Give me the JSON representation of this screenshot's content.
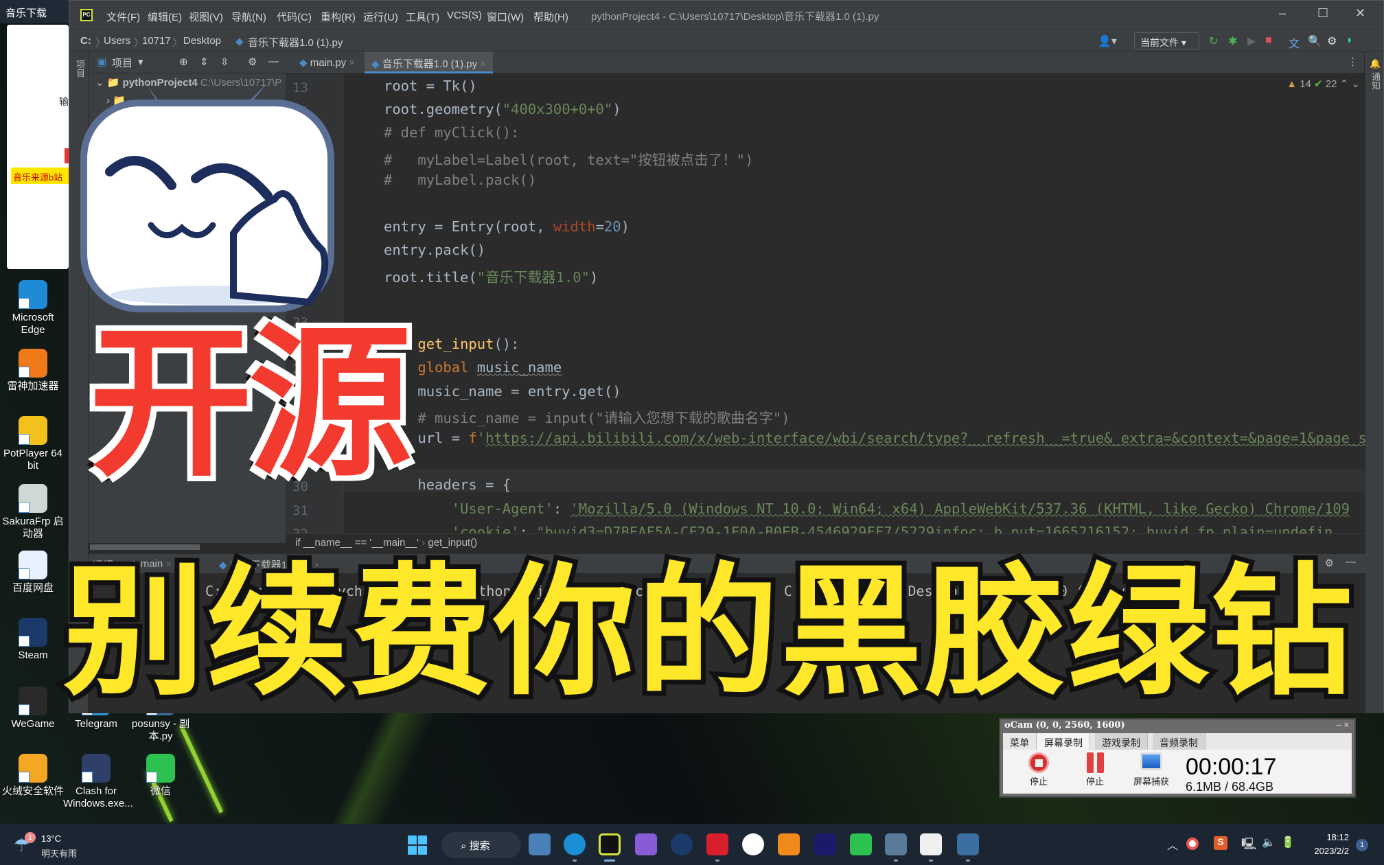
{
  "left_window": {
    "title": "音乐下载",
    "tag": "音乐来源b站",
    "char": "输"
  },
  "desktop_icons": [
    {
      "label": "Microsoft Edge",
      "color": "#1f8ad6"
    },
    {
      "label": "雷神加速器",
      "color": "#f07a1a"
    },
    {
      "label": "PotPlayer 64 bit",
      "color": "#f2c21a"
    },
    {
      "label": "SakuraFrp 启动器",
      "color": "#cfd8d4"
    },
    {
      "label": "百度网盘",
      "color": "#e8f1ff"
    },
    {
      "label": "Steam",
      "color": "#1b3a6a"
    },
    {
      "label": "WeGame",
      "color": "#2a2a2a"
    },
    {
      "label": "火绒安全软件",
      "color": "#f5a623"
    },
    {
      "label": "Telegram",
      "color": "#2aa0da"
    },
    {
      "label": "posunsy - 副本.py",
      "color": "#3b6fa0"
    },
    {
      "label": "Clash for Windows.exe...",
      "color": "#2e3f6a"
    },
    {
      "label": "微信",
      "color": "#2dc150"
    }
  ],
  "ide": {
    "menu": [
      "文件(F)",
      "编辑(E)",
      "视图(V)",
      "导航(N)",
      "代码(C)",
      "重构(R)",
      "运行(U)",
      "工具(T)",
      "VCS(S)",
      "窗口(W)",
      "帮助(H)"
    ],
    "window_title": "pythonProject4 - C:\\Users\\10717\\Desktop\\音乐下载器1.0 (1).py",
    "breadcrumbs": [
      "C:",
      "Users",
      "10717",
      "Desktop",
      "音乐下载器1.0 (1).py"
    ],
    "run_config": "当前文件",
    "project_tab": "项目",
    "project_root": "pythonProject4",
    "project_path": "C:\\Users\\10717\\P",
    "side_label_left": "项目",
    "side_label_right": "通知",
    "file_tabs": [
      {
        "label": "main.py",
        "active": false
      },
      {
        "label": "音乐下载器1.0 (1).py",
        "active": true
      }
    ],
    "inspections": {
      "warnings": "14",
      "ok": "22"
    },
    "code": [
      {
        "n": "13",
        "t": [
          [
            "",
            "root = Tk()"
          ]
        ]
      },
      {
        "n": "14",
        "t": [
          [
            "",
            "root.geometry("
          ],
          [
            "str",
            "\"400x300+0+0\""
          ],
          [
            "",
            ")"
          ]
        ]
      },
      {
        "n": "15",
        "t": [
          [
            "cm",
            "# def myClick():"
          ]
        ]
      },
      {
        "n": "16",
        "t": [
          [
            "cm",
            "#   myLabel=Label(root, text=\"按钮被点击了！\")"
          ]
        ]
      },
      {
        "n": "17",
        "t": [
          [
            "cm",
            "#   myLabel.pack()"
          ]
        ]
      },
      {
        "n": "18",
        "t": []
      },
      {
        "n": "19",
        "t": [
          [
            "",
            "entry = Entry(root, "
          ],
          [
            "param",
            "width"
          ],
          [
            "",
            "="
          ],
          [
            "num",
            "20"
          ],
          [
            "",
            ")"
          ]
        ]
      },
      {
        "n": "20",
        "t": [
          [
            "",
            "entry.pack()"
          ]
        ]
      },
      {
        "n": "21",
        "t": [
          [
            "",
            "root.title("
          ],
          [
            "str",
            "\"音乐下载器1.0\""
          ],
          [
            "",
            ")"
          ]
        ]
      },
      {
        "n": "22",
        "t": []
      },
      {
        "n": "23",
        "t": []
      },
      {
        "n": "24",
        "t": [
          [
            "kw",
            "def "
          ],
          [
            "fn",
            "get_input"
          ],
          [
            "",
            "():"
          ]
        ]
      },
      {
        "n": "25",
        "t": [
          [
            "",
            "    "
          ],
          [
            "kw",
            "global "
          ],
          [
            "ul",
            "music_name"
          ]
        ]
      },
      {
        "n": "26",
        "t": [
          [
            "",
            "    music_name = entry.get()"
          ]
        ]
      },
      {
        "n": "27",
        "t": [
          [
            "cm",
            "    # music_name = input(\"请输入您想下载的歌曲名字\")"
          ]
        ]
      },
      {
        "n": "28",
        "t": [
          [
            "",
            "    url = "
          ],
          [
            "kw",
            "f"
          ],
          [
            "str",
            "'"
          ],
          [
            "url",
            "https://api.bilibili.com/x/web-interface/wbi/search/type?__refresh__=true&_extra=&context=&page=1&page_size=42"
          ]
        ]
      },
      {
        "n": "29",
        "t": []
      },
      {
        "n": "30",
        "t": [
          [
            "",
            "    headers = {"
          ]
        ]
      },
      {
        "n": "31",
        "t": [
          [
            "",
            "        "
          ],
          [
            "str",
            "'User-Agent'"
          ],
          [
            "",
            ": "
          ],
          [
            "url",
            "'Mozilla/5.0 (Windows NT 10.0; Win64; x64) AppleWebKit/537.36 (KHTML, like Gecko) Chrome/109"
          ]
        ]
      },
      {
        "n": "32",
        "t": [
          [
            "",
            "        "
          ],
          [
            "str",
            "'cookie'"
          ],
          [
            "",
            ": "
          ],
          [
            "str",
            "\"buvid3=D7BEAF5A-CF29-1F0A-B0EB-4546929FF7/5229infoc; b_nut=1665216152; buvid_fp_plain=undefin"
          ]
        ]
      }
    ],
    "code_breadcrumb": [
      "if __name__ == '__main__'",
      "get_input()"
    ],
    "run_label": "运行:",
    "run_tabs": [
      "main",
      "音乐下载器1.0 (1)"
    ],
    "run_output": "C:\\Users\\10717\\PycharmProjects\\pythonProject4\\venv\\Scripts\\python.exe C:\\Users\\10717\\Desktop\\音乐下载器1.0 (1).py"
  },
  "overlay": {
    "headline_red": "开源",
    "headline_yellow": "别续费你的黑胶绿钻",
    "red": "#f23a2e",
    "yellow": "#ffe82a"
  },
  "ocam": {
    "title": "oCam (0, 0, 2560, 1600)",
    "tabs": [
      "菜单",
      "屏幕录制",
      "游戏录制",
      "音频录制"
    ],
    "selected_tab": "屏幕录制",
    "buttons": [
      "停止",
      "停止",
      "屏幕捕获"
    ],
    "time": "00:00:17",
    "size": "6.1MB / 68.4GB"
  },
  "taskbar": {
    "weather_temp": "13°C",
    "weather_desc": "明天有雨",
    "weather_badge": "1",
    "search": "搜索",
    "apps": [
      "settings",
      "edge",
      "pycharm",
      "visual-studio",
      "steam",
      "netease-music",
      "android-studio",
      "everything",
      "premiere",
      "wechat",
      "calculator",
      "ocam",
      "python-idle"
    ],
    "time": "18:12",
    "date": "2023/2/2",
    "notification_count": "1"
  }
}
